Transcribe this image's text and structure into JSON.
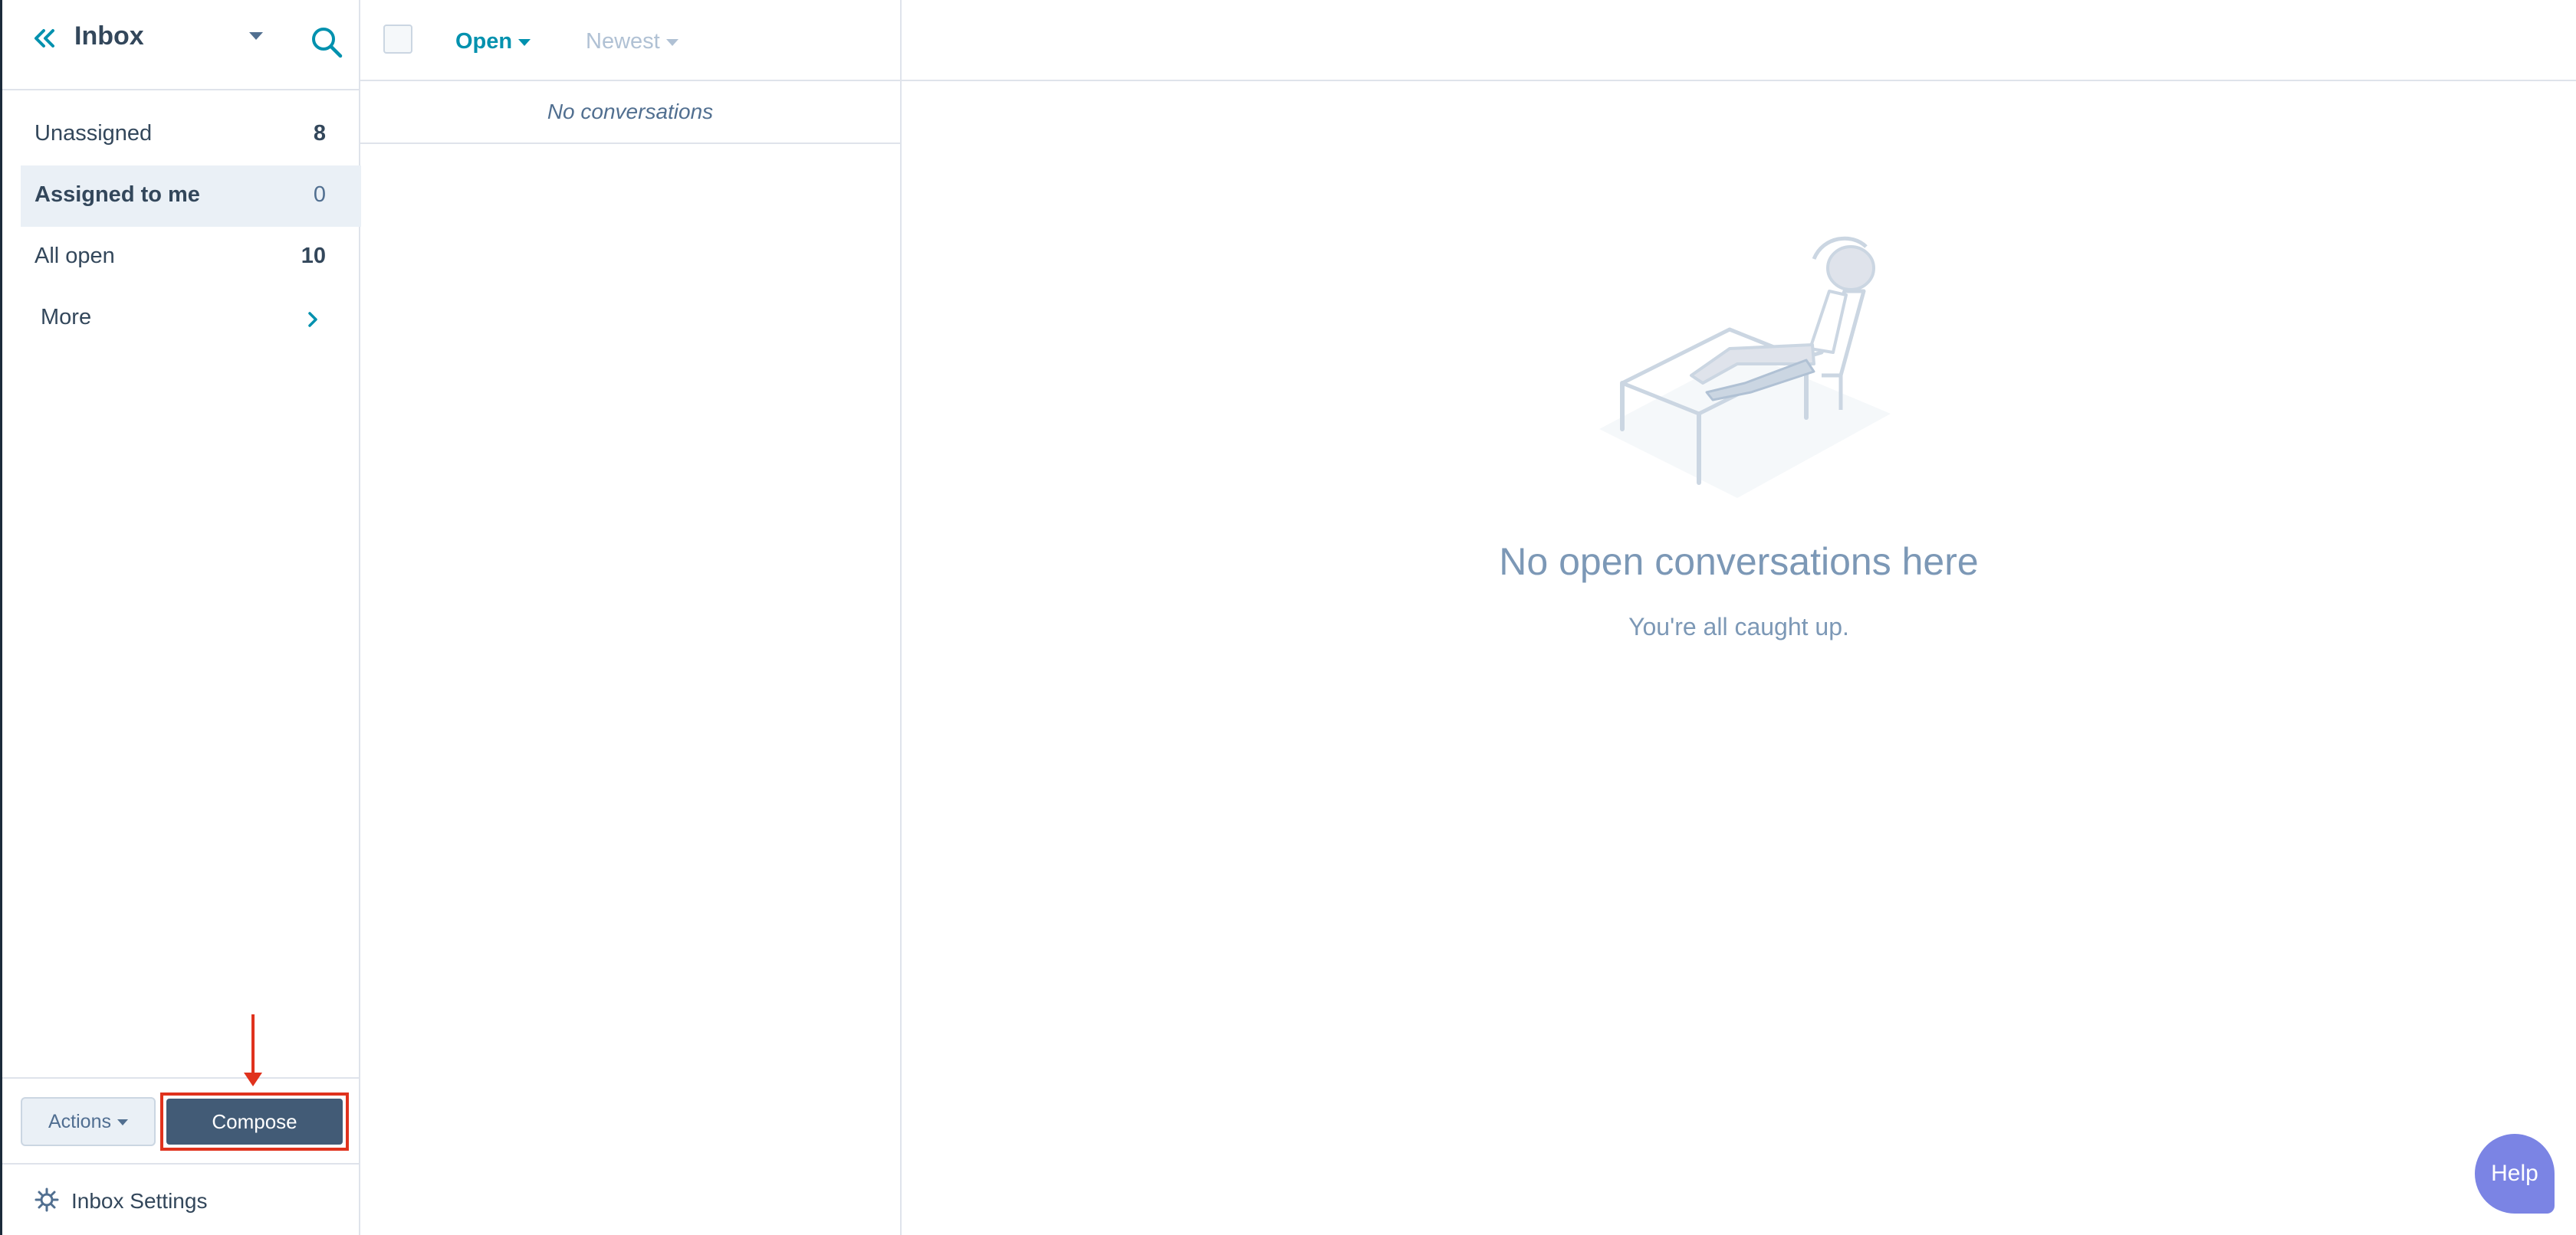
{
  "sidebar": {
    "title": "Inbox",
    "items": [
      {
        "label": "Unassigned",
        "count": "8"
      },
      {
        "label": "Assigned to me",
        "count": "0"
      },
      {
        "label": "All open",
        "count": "10"
      },
      {
        "label": "More"
      }
    ],
    "actions_label": "Actions",
    "compose_label": "Compose",
    "settings_label": "Inbox Settings"
  },
  "list": {
    "status_filter": "Open",
    "sort_filter": "Newest",
    "empty_text": "No conversations"
  },
  "main": {
    "empty_title": "No open conversations here",
    "empty_subtitle": "You're all caught up."
  },
  "help_label": "Help",
  "colors": {
    "accent": "#0091ae",
    "compose_bg": "#425b76",
    "highlight": "#e0321d",
    "help_bg": "#7b84e4"
  }
}
